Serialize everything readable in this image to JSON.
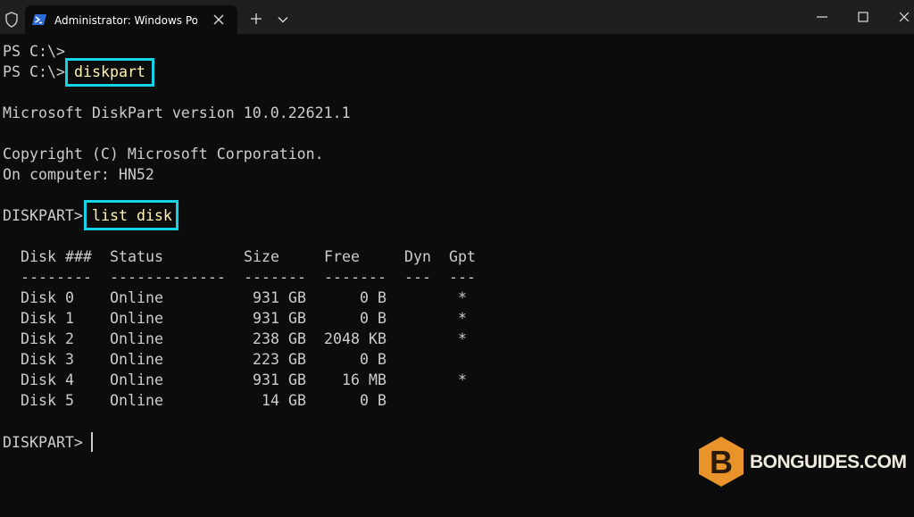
{
  "window": {
    "tab_title": "Administrator: Windows PowerShell",
    "icons": [
      "shield-icon",
      "powershell-icon",
      "close-icon",
      "plus-icon",
      "chevron-down-icon",
      "minimize-icon",
      "maximize-icon",
      "window-close-icon"
    ]
  },
  "terminal": {
    "lines": {
      "l1": "PS C:\\>",
      "l2_prompt": "PS C:\\>",
      "l2_cmd": "diskpart",
      "l3": "Microsoft DiskPart version 10.0.22621.1",
      "l4": "Copyright (C) Microsoft Corporation.",
      "l5": "On computer: HN52",
      "l6_prompt": "DISKPART>",
      "l6_cmd": "list disk",
      "last_prompt": "DISKPART>"
    },
    "table": {
      "headers": [
        "Disk ###",
        "Status",
        "Size",
        "Free",
        "Dyn",
        "Gpt"
      ],
      "separators": [
        "--------",
        "-------------",
        "-------",
        "-------",
        "---",
        "---"
      ],
      "rows": [
        [
          "Disk 0",
          "Online",
          "931 GB",
          "0 B",
          "",
          "*"
        ],
        [
          "Disk 1",
          "Online",
          "931 GB",
          "0 B",
          "",
          "*"
        ],
        [
          "Disk 2",
          "Online",
          "238 GB",
          "2048 KB",
          "",
          "*"
        ],
        [
          "Disk 3",
          "Online",
          "223 GB",
          "0 B",
          "",
          ""
        ],
        [
          "Disk 4",
          "Online",
          "931 GB",
          "16 MB",
          "",
          "*"
        ],
        [
          "Disk 5",
          "Online",
          "14 GB",
          "0 B",
          "",
          ""
        ]
      ]
    }
  },
  "watermark": {
    "logo_letter": "B",
    "text": "BONGUIDES.COM"
  },
  "colors": {
    "terminal_bg": "#0c0c0c",
    "text": "#cccccc",
    "command": "#fff3b3",
    "highlight": "#16d2e6",
    "logo": "#e8942a"
  }
}
